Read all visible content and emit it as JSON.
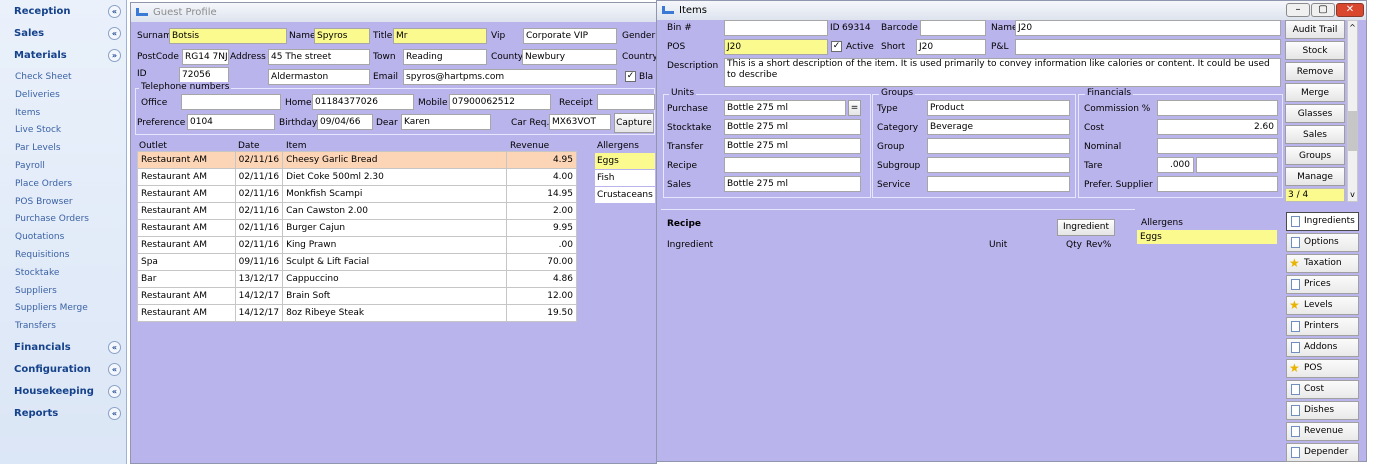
{
  "sidebar": {
    "sections": [
      {
        "label": "Reception",
        "chevron": "«"
      },
      {
        "label": "Sales",
        "chevron": "«"
      },
      {
        "label": "Materials",
        "chevron": "»"
      },
      {
        "label": "Financials",
        "chevron": "«"
      },
      {
        "label": "Configuration",
        "chevron": "«"
      },
      {
        "label": "Housekeeping",
        "chevron": "«"
      },
      {
        "label": "Reports",
        "chevron": "«"
      }
    ],
    "materials_items": [
      "Check Sheet",
      "Deliveries",
      "Items",
      "Live Stock",
      "Par Levels",
      "Payroll",
      "Place Orders",
      "POS Browser",
      "Purchase Orders",
      "Quotations",
      "Requisitions",
      "Stocktake",
      "Suppliers",
      "Suppliers Merge",
      "Transfers"
    ]
  },
  "guest": {
    "title": "Guest Profile",
    "surname_label": "Surname",
    "surname": "Botsis",
    "name_label": "Name",
    "name": "Spyros",
    "title_label": "Title",
    "title_value": "Mr",
    "vip_label": "Vip",
    "vip": "Corporate VIP",
    "gender_label": "Gender",
    "postcode_label": "PostCode",
    "postcode": "RG14 7NJ",
    "address_label": "Address",
    "address": "45 The street",
    "town_label": "Town",
    "town": "Reading",
    "county_label": "County",
    "county": "Newbury",
    "country_label": "Country",
    "id_label": "ID",
    "id": "72056",
    "address2": "Aldermaston",
    "email_label": "Email",
    "email": "spyros@hartpms.com",
    "black_label": "Bla",
    "telephone_label": "Telephone numbers",
    "office_label": "Office",
    "home_label": "Home",
    "home": "01184377026",
    "mobile_label": "Mobile",
    "mobile": "07900062512",
    "receipt_label": "Receipt",
    "preference_label": "Preference",
    "preference": "0104",
    "birthday_label": "Birthday",
    "birthday": "09/04/66",
    "dear_label": "Dear",
    "dear": "Karen",
    "carreq_label": "Car Req.",
    "carreq": "MX63VOT",
    "capture_label": "Capture",
    "table_headers": [
      "Outlet",
      "Date",
      "Item",
      "Revenue"
    ],
    "rows": [
      [
        "Restaurant AM",
        "02/11/16",
        "Cheesy Garlic Bread",
        "4.95"
      ],
      [
        "Restaurant AM",
        "02/11/16",
        "Diet Coke 500ml 2.30",
        "4.00"
      ],
      [
        "Restaurant AM",
        "02/11/16",
        "Monkfish Scampi",
        "14.95"
      ],
      [
        "Restaurant AM",
        "02/11/16",
        "Can Cawston 2.00",
        "2.00"
      ],
      [
        "Restaurant AM",
        "02/11/16",
        "Burger Cajun",
        "9.95"
      ],
      [
        "Restaurant AM",
        "02/11/16",
        "King Prawn",
        ".00"
      ],
      [
        "Spa",
        "09/11/16",
        "Sculpt & Lift Facial",
        "70.00"
      ],
      [
        "Bar",
        "13/12/17",
        "Cappuccino",
        "4.86"
      ],
      [
        "Restaurant AM",
        "14/12/17",
        "Brain Soft",
        "12.00"
      ],
      [
        "Restaurant AM",
        "14/12/17",
        "8oz Ribeye Steak",
        "19.50"
      ]
    ],
    "allergens_header": "Allergens",
    "allergens": [
      "Eggs",
      "Fish",
      "Crustaceans"
    ]
  },
  "items": {
    "title": "Items",
    "bin_label": "Bin #",
    "id_label": "ID",
    "id": "69314",
    "barcode_label": "Barcode",
    "name_label": "Name",
    "name": "J20",
    "pos_label": "POS",
    "pos": "J20",
    "active_label": "Active",
    "short_label": "Short",
    "short": "J20",
    "pl_label": "P&L",
    "description_label": "Description",
    "description": "This is a short description of the item. It is used primarily to convey information like calories or content. It could be used to describe",
    "units_title": "Units",
    "purchase_label": "Purchase",
    "purchase": "Bottle 275 ml",
    "stocktake_label": "Stocktake",
    "stocktake": "Bottle 275 ml",
    "transfer_label": "Transfer",
    "transfer": "Bottle 275 ml",
    "recipe_label": "Recipe",
    "sales_label": "Sales",
    "sales": "Bottle 275 ml",
    "groups_title": "Groups",
    "type_label": "Type",
    "type": "Product",
    "category_label": "Category",
    "category": "Beverage",
    "group_label": "Group",
    "subgroup_label": "Subgroup",
    "service_label": "Service",
    "financials_title": "Financials",
    "commission_label": "Commission %",
    "cost_label": "Cost",
    "cost": "2.60",
    "nominal_label": "Nominal",
    "tare_label": "Tare",
    "tare": ".000",
    "prefer_label": "Prefer. Supplier",
    "side_buttons": [
      "Audit Trail",
      "Stock",
      "Remove",
      "Merge",
      "Glasses",
      "Sales",
      "Groups",
      "Manage"
    ],
    "pager": "3 / 4",
    "recipe_title": "Recipe",
    "ingredient_button": "Ingredient",
    "ingredient_col": "Ingredient",
    "unit_col": "Unit",
    "qty_col": "Qty",
    "rev_col": "Rev%",
    "allergens_header": "Allergens",
    "allergens": [
      "Eggs"
    ],
    "tabs": [
      {
        "label": "Ingredients",
        "icon": "doc"
      },
      {
        "label": "Options",
        "icon": "doc"
      },
      {
        "label": "Taxation",
        "icon": "star"
      },
      {
        "label": "Prices",
        "icon": "doc"
      },
      {
        "label": "Levels",
        "icon": "star"
      },
      {
        "label": "Printers",
        "icon": "doc"
      },
      {
        "label": "Addons",
        "icon": "doc"
      },
      {
        "label": "POS",
        "icon": "star"
      },
      {
        "label": "Cost",
        "icon": "doc"
      },
      {
        "label": "Dishes",
        "icon": "doc"
      },
      {
        "label": "Revenue",
        "icon": "doc"
      },
      {
        "label": "Depender",
        "icon": "doc"
      }
    ],
    "window_controls": [
      "–",
      "▢",
      "✕"
    ]
  }
}
